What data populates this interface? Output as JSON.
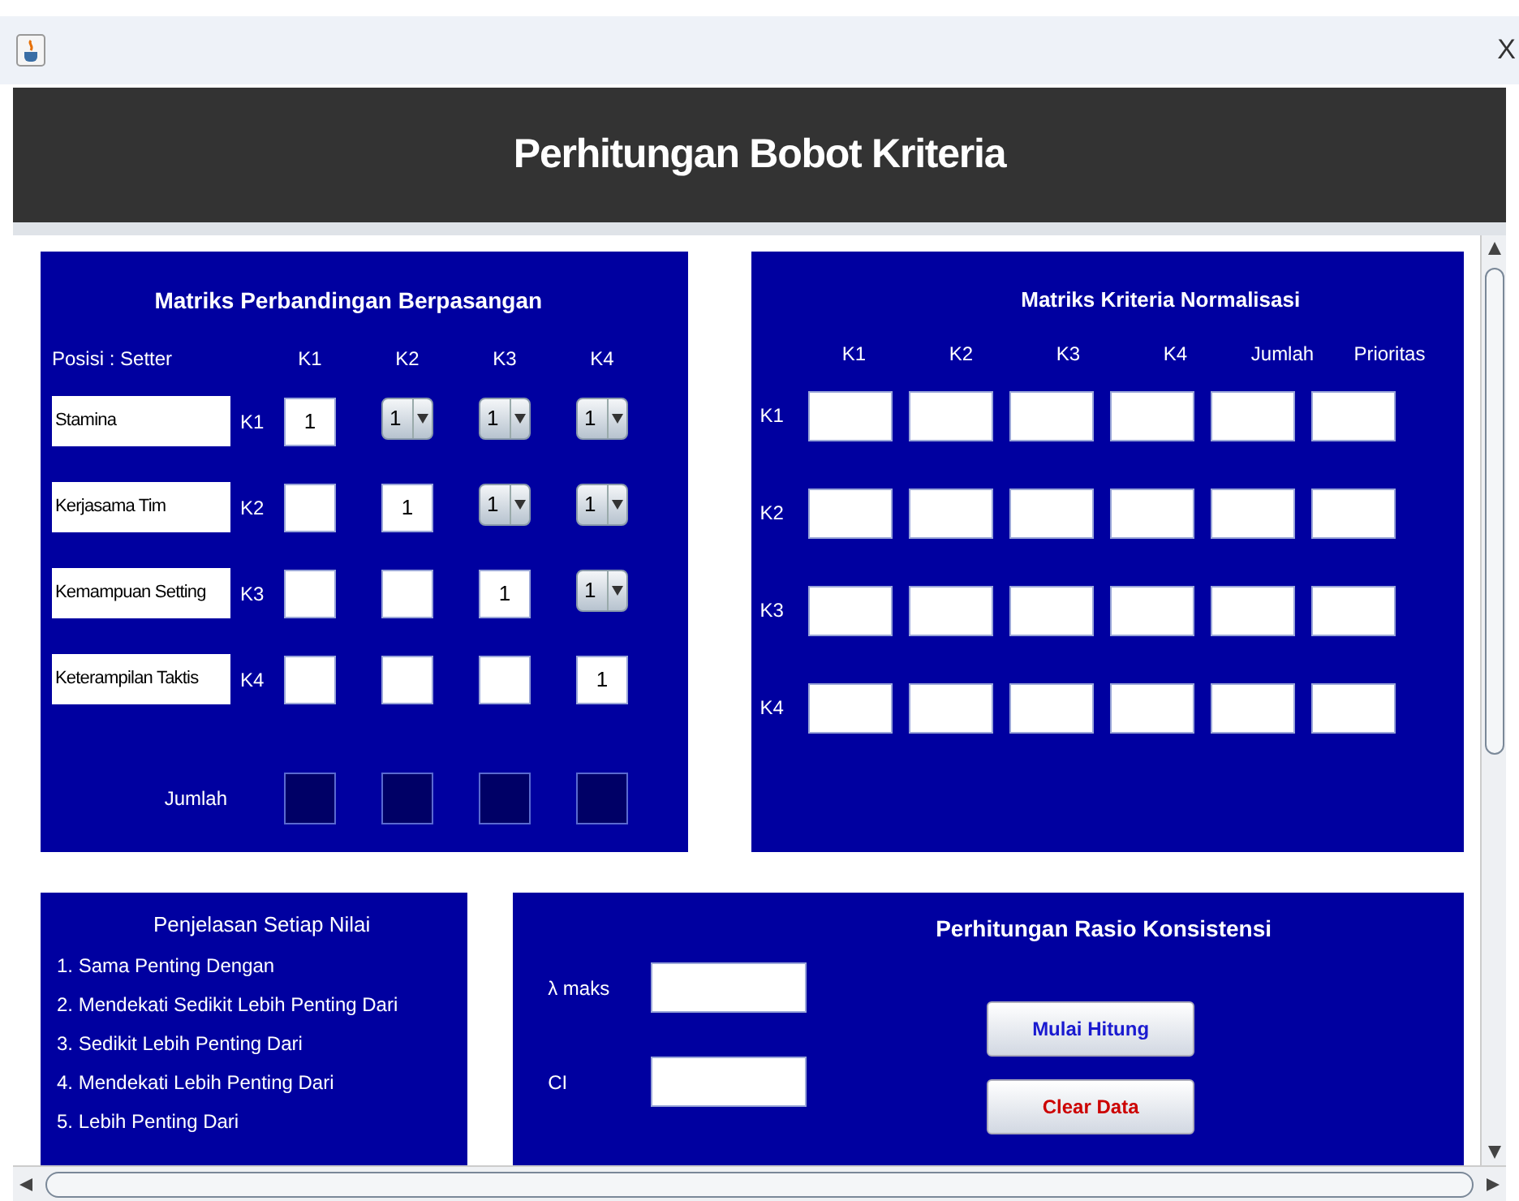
{
  "window": {
    "title": "X"
  },
  "header": {
    "title": "Perhitungan Bobot Kriteria"
  },
  "pairwise": {
    "title": "Matriks Perbandingan Berpasangan",
    "position": "Posisi :  Setter",
    "columns": [
      "K1",
      "K2",
      "K3",
      "K4"
    ],
    "rows": [
      {
        "name": "Stamina",
        "code": "K1",
        "cells": [
          {
            "kind": "field",
            "value": "1"
          },
          {
            "kind": "select",
            "value": "1"
          },
          {
            "kind": "select",
            "value": "1"
          },
          {
            "kind": "select",
            "value": "1"
          }
        ]
      },
      {
        "name": "Kerjasama Tim",
        "code": "K2",
        "cells": [
          {
            "kind": "field"
          },
          {
            "kind": "field",
            "value": "1"
          },
          {
            "kind": "select",
            "value": "1"
          },
          {
            "kind": "select",
            "value": "1"
          }
        ]
      },
      {
        "name": "Kemampuan Setting",
        "code": "K3",
        "cells": [
          {
            "kind": "field"
          },
          {
            "kind": "field"
          },
          {
            "kind": "field",
            "value": "1"
          },
          {
            "kind": "select",
            "value": "1"
          }
        ]
      },
      {
        "name": "Keterampilan Taktis",
        "code": "K4",
        "cells": [
          {
            "kind": "field"
          },
          {
            "kind": "field"
          },
          {
            "kind": "field"
          },
          {
            "kind": "field",
            "value": "1"
          }
        ]
      }
    ],
    "total_label": "Jumlah"
  },
  "normalized": {
    "title": "Matriks Kriteria Normalisasi",
    "columns": [
      "K1",
      "K2",
      "K3",
      "K4",
      "Jumlah",
      "Prioritas"
    ],
    "rows": [
      "K1",
      "K2",
      "K3",
      "K4"
    ]
  },
  "legend": {
    "title": "Penjelasan Setiap Nilai",
    "items": [
      "1. Sama Penting Dengan",
      "2. Mendekati Sedikit Lebih Penting Dari",
      "3. Sedikit Lebih Penting Dari",
      "4. Mendekati Lebih Penting Dari",
      "5. Lebih Penting Dari"
    ]
  },
  "consistency": {
    "title": "Perhitungan Rasio Konsistensi",
    "fields": [
      {
        "label": "λ maks"
      },
      {
        "label": "CI"
      }
    ],
    "buttons": [
      {
        "label": "Mulai Hitung",
        "kind": "primary"
      },
      {
        "label": "Clear Data",
        "kind": "danger"
      }
    ]
  }
}
